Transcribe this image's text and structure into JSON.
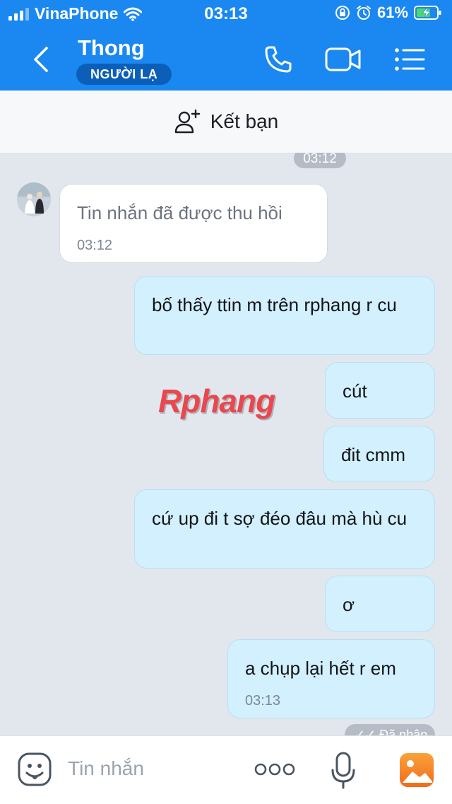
{
  "status_bar": {
    "carrier": "VinaPhone",
    "time": "03:13",
    "battery": "61%",
    "icons": [
      "signal-icon",
      "wifi-icon",
      "rotation-lock-icon",
      "alarm-icon",
      "battery-charging-icon"
    ]
  },
  "header": {
    "contact_name": "Thong",
    "badge": "NGƯỜI LẠ",
    "icons": [
      "back-icon",
      "phone-icon",
      "video-call-icon",
      "menu-icon"
    ]
  },
  "add_friend": {
    "label": "Kết bạn"
  },
  "chat": {
    "top_timestamp": "03:12",
    "messages": [
      {
        "direction": "in",
        "text": "Tin nhắn đã được thu hồi",
        "time": "03:12",
        "recalled": true
      },
      {
        "direction": "out",
        "text": "bố thấy ttin m trên rphang r cu"
      },
      {
        "direction": "out",
        "text": "cút"
      },
      {
        "direction": "out",
        "text": "đit cmm"
      },
      {
        "direction": "out",
        "text": "cứ up đi t sợ đéo đâu mà hù cu"
      },
      {
        "direction": "out",
        "text": "ơ"
      },
      {
        "direction": "out",
        "text": "a chụp lại hết r em",
        "time": "03:13"
      }
    ],
    "watermark": "Rphang",
    "seen_status": "Đã nhận"
  },
  "input_bar": {
    "placeholder": "Tin nhắn",
    "icons": [
      "sticker-icon",
      "more-icon",
      "microphone-icon",
      "image-gallery-icon"
    ]
  },
  "colors": {
    "header_blue": "#1a88f0",
    "badge_blue": "#0b5fb8",
    "outgoing_bubble": "#d3f0fe",
    "chat_background": "#e2e7ee",
    "gallery_orange": "#f5821f"
  }
}
